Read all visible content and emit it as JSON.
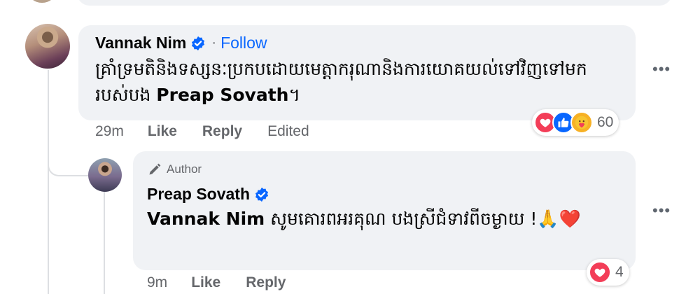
{
  "comments": [
    {
      "author": "Vannak Nim",
      "follow_label": "Follow",
      "separator": "·",
      "text": "គ្រាំទ្រមតិនិងទស្សនៈប្រកបដោយមេត្តាករុណានិងការយោគយល់ទៅវិញទៅមករបស់បង ",
      "mention": "Preap Sovath",
      "text_end": "។",
      "time": "29m",
      "like_label": "Like",
      "reply_label": "Reply",
      "edited_label": "Edited",
      "reaction_count": "60",
      "reactions": [
        "love-icon",
        "like-icon",
        "care-icon"
      ],
      "more_label": "•••"
    },
    {
      "badge": "Author",
      "author": "Preap Sovath",
      "mention": "Vannak Nim",
      "text": " សូមគោរពអរគុណ បងស្រីជំទាវពីចម្ងាយ !",
      "emoji": "🙏❤️",
      "time": "9m",
      "like_label": "Like",
      "reply_label": "Reply",
      "reaction_count": "4",
      "reactions": [
        "love-icon"
      ],
      "more_label": "•••"
    }
  ],
  "colors": {
    "bubble": "#f0f2f5",
    "link_blue": "#0866ff",
    "secondary_text": "#65676b",
    "love_red": "#f33e58"
  }
}
